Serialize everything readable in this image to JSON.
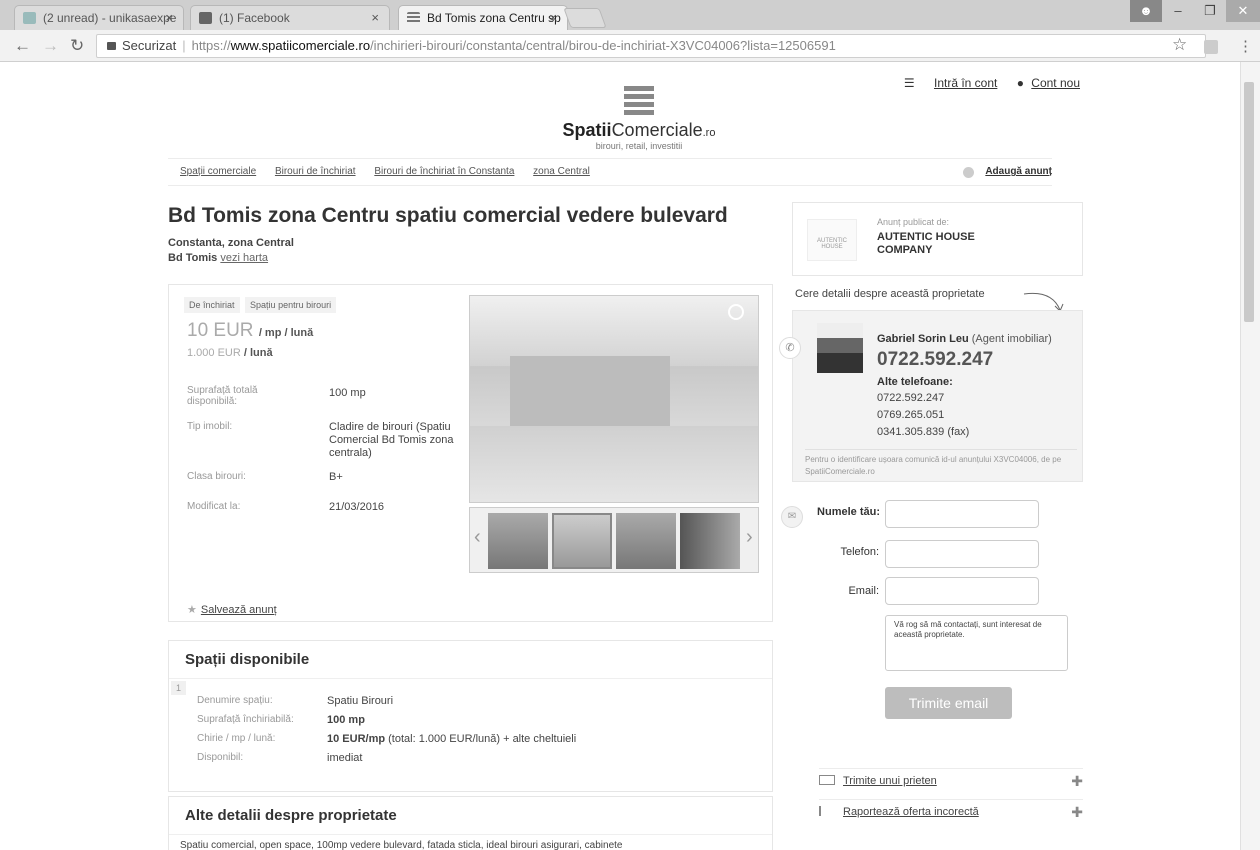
{
  "browser": {
    "tabs": [
      {
        "label": "(2 unread) - unikasaexpe"
      },
      {
        "label": "(1) Facebook"
      },
      {
        "label": "Bd Tomis zona Centru sp"
      }
    ],
    "security_label": "Securizat",
    "url_scheme": "https://",
    "url_host": "www.spatiicomerciale.ro",
    "url_path": "/inchirieri-birouri/constanta/central/birou-de-inchiriat-X3VC04006?lista=12506591"
  },
  "header": {
    "login_label": "Intră în cont",
    "signup_label": "Cont nou",
    "logo_name_bold": "Spatii",
    "logo_name_rest": "Comerciale",
    "logo_tld": ".ro",
    "logo_subtitle": "birouri, retail, investitii"
  },
  "breadcrumbs": {
    "items": [
      "Spații comerciale",
      "Birouri de închiriat",
      "Birouri de închiriat în Constanta",
      "zona Central"
    ],
    "add_label": "Adaugă anunț"
  },
  "listing": {
    "title": "Bd Tomis zona Centru spatiu comercial vedere bulevard",
    "location": "Constanta, zona Central",
    "street": "Bd Tomis",
    "map_link": "vezi harta",
    "tags": [
      "De închiriat",
      "Spațiu pentru birouri"
    ],
    "price_main": "10 EUR",
    "price_unit": "/ mp / lună",
    "price_total": "1.000 EUR",
    "price_total_unit": "/ lună",
    "details": [
      {
        "label": "Suprafață totală disponibilă:",
        "value": "100 mp"
      },
      {
        "label": "Tip imobil:",
        "value": "Cladire de birouri (Spatiu Comercial Bd Tomis zona centrala)"
      },
      {
        "label": "Clasa birouri:",
        "value": "B+"
      },
      {
        "label": "Modificat la:",
        "value": "21/03/2016"
      }
    ],
    "save_label": "Salvează anunț"
  },
  "spaces": {
    "heading": "Spații disponibile",
    "index": "1",
    "rows": [
      {
        "label": "Denumire spațiu:",
        "value": "Spatiu Birouri"
      },
      {
        "label": "Suprafață închiriabilă:",
        "value": "100 mp"
      },
      {
        "label": "Chirie / mp / lună:",
        "value": "10 EUR/mp",
        "extra": "(total: 1.000 EUR/lună) + alte cheltuieli"
      },
      {
        "label": "Disponibil:",
        "value": "imediat"
      }
    ]
  },
  "other_details": {
    "heading": "Alte detalii despre proprietate",
    "text": "Spatiu comercial, open space, 100mp vedere bulevard, fatada sticla, ideal birouri asigurari, cabinete"
  },
  "publisher": {
    "label": "Anunț publicat de:",
    "name": "AUTENTIC HOUSE COMPANY",
    "logo_text": "AUTENTIC HOUSE"
  },
  "contact": {
    "prompt": "Cere detalii despre această proprietate",
    "agent_name": "Gabriel Sorin Leu",
    "agent_role": "(Agent imobiliar)",
    "main_phone": "0722.592.247",
    "alt_label": "Alte telefoane:",
    "phones": [
      "0722.592.247",
      "0769.265.051",
      "0341.305.839 (fax)"
    ],
    "id_note": "Pentru o identificare ușoara comunică id-ul anunțului X3VC04006, de pe SpatiiComerciale.ro"
  },
  "form": {
    "name_label": "Numele tău:",
    "phone_label": "Telefon:",
    "email_label": "Email:",
    "message": "Vă rog să mă contactați, sunt interesat de această proprietate.",
    "send_label": "Trimite email"
  },
  "side_links": {
    "friend": "Trimite unui prieten",
    "report": "Raportează oferta incorectă"
  }
}
